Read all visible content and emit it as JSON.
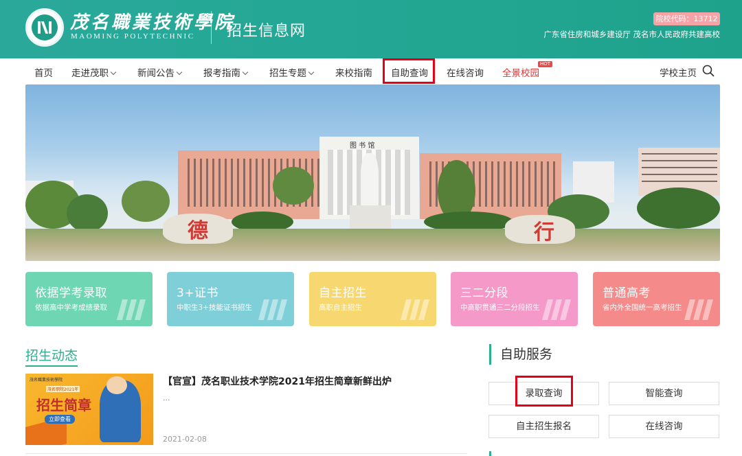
{
  "header": {
    "school_name_cn": "茂名職業技術學院",
    "school_name_en": "MAOMING POLYTECHNIC",
    "site_name": "招生信息网",
    "school_code": "院校代码：13712",
    "co_built": "广东省住房和城乡建设厅 茂名市人民政府共建高校"
  },
  "nav": {
    "items": [
      {
        "label": "首页"
      },
      {
        "label": "走进茂职"
      },
      {
        "label": "新闻公告"
      },
      {
        "label": "报考指南"
      },
      {
        "label": "招生专题"
      },
      {
        "label": "来校指南"
      },
      {
        "label": "自助查询"
      },
      {
        "label": "在线咨询"
      },
      {
        "label": "全景校园"
      }
    ],
    "hot_badge": "HOT",
    "school_home": "学校主页"
  },
  "banner": {
    "building_sign": "图 书 馆",
    "stone_left": "德",
    "stone_right": "行"
  },
  "cards": [
    {
      "title": "依据学考录取",
      "subtitle": "依据高中学考成绩录取",
      "color": "#6fd6b3"
    },
    {
      "title": "3+证书",
      "subtitle": "中职生3+技能证书招生",
      "color": "#7fcfd8"
    },
    {
      "title": "自主招生",
      "subtitle": "高职自主招生",
      "color": "#f7d770"
    },
    {
      "title": "三二分段",
      "subtitle": "中高职贯通三二分段招生",
      "color": "#f59ac8"
    },
    {
      "title": "普通高考",
      "subtitle": "省内外全国统一高考招生",
      "color": "#f58a8a"
    }
  ],
  "news": {
    "section_title": "招生动态",
    "items": [
      {
        "title": "【官宣】茂名职业技术学院2021年招生简章新鲜出炉",
        "desc": "...",
        "date": "2021-02-08",
        "image_heading": "招生简章",
        "image_year": "茂名职院2021年",
        "image_button": "立即查看",
        "image_logo_text": "茂名職業技術學院"
      }
    ]
  },
  "services": {
    "title": "自助服务",
    "buttons": [
      {
        "label": "录取查询"
      },
      {
        "label": "智能查询"
      },
      {
        "label": "自主招生报名"
      },
      {
        "label": "在线咨询"
      }
    ]
  },
  "colors": {
    "header_bg": "#22a692",
    "accent": "#2bb08f",
    "highlight": "#e5001a"
  }
}
